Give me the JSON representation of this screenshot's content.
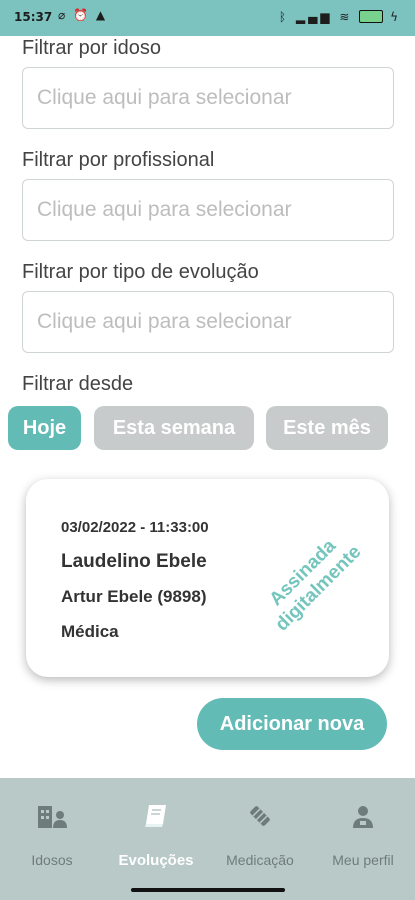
{
  "status_bar": {
    "time": "15:37",
    "left_icons": [
      "notification-muted-icon",
      "alarm-icon",
      "warning-icon"
    ],
    "right_icons": [
      "bluetooth-icon",
      "signal-icon",
      "wifi-icon",
      "battery-icon",
      "charging-icon"
    ]
  },
  "filters": {
    "elderly": {
      "label": "Filtrar por idoso",
      "placeholder": "Clique aqui para selecionar"
    },
    "professional": {
      "label": "Filtrar por profissional",
      "placeholder": "Clique aqui para selecionar"
    },
    "evolution_type": {
      "label": "Filtrar por tipo de evolução",
      "placeholder": "Clique aqui para selecionar"
    },
    "since": {
      "label": "Filtrar desde",
      "options": [
        "Hoje",
        "Esta semana",
        "Este mês"
      ],
      "selected": "Hoje"
    }
  },
  "evolution_card": {
    "datetime": "03/02/2022 - 11:33:00",
    "professional_name": "Laudelino Ebele",
    "patient": "Artur Ebele (9898)",
    "type": "Médica",
    "stamp_line1": "Assinada",
    "stamp_line2": "digitalmente"
  },
  "add_button_label": "Adicionar nova",
  "bottom_nav": {
    "items": [
      {
        "label": "Idosos",
        "icon": "building-people-icon"
      },
      {
        "label": "Evoluções",
        "icon": "book-icon"
      },
      {
        "label": "Medicação",
        "icon": "pill-icon"
      },
      {
        "label": "Meu perfil",
        "icon": "user-profile-icon"
      }
    ],
    "active": "Evoluções"
  },
  "colors": {
    "accent": "#63bbb5",
    "status_bar": "#7cc3c0",
    "inactive_chip": "#c8cbcb",
    "nav_background": "#b8c9c7",
    "stamp": "#74c5bd"
  }
}
